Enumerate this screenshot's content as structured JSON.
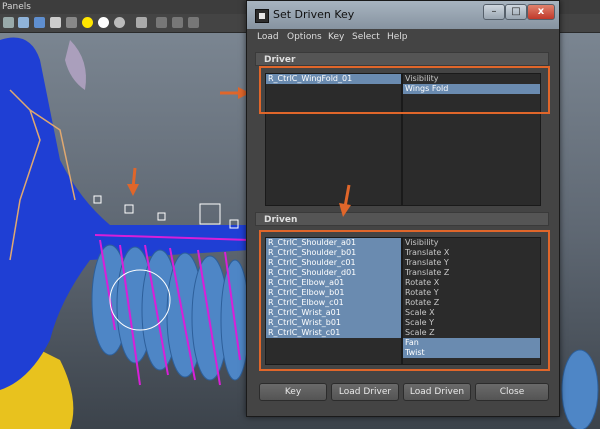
{
  "background": {
    "menu_label": "Panels"
  },
  "dialog": {
    "title": "Set Driven Key",
    "window_buttons": {
      "minimize": "–",
      "maximize": "□",
      "close": "x"
    },
    "menu": [
      "Load",
      "Options",
      "Key",
      "Select",
      "Help"
    ],
    "driver": {
      "header": "Driver",
      "objects": [
        {
          "label": "R_CtrlC_WingFold_01",
          "selected": true
        }
      ],
      "attributes": [
        {
          "label": "Visibility",
          "selected": false
        },
        {
          "label": "Wings Fold",
          "selected": true
        }
      ]
    },
    "driven": {
      "header": "Driven",
      "objects": [
        {
          "label": "R_CtrlC_Shoulder_a01",
          "selected": true
        },
        {
          "label": "R_CtrlC_Shoulder_b01",
          "selected": true
        },
        {
          "label": "R_CtrlC_Shoulder_c01",
          "selected": true
        },
        {
          "label": "R_CtrlC_Shoulder_d01",
          "selected": true
        },
        {
          "label": "R_CtrlC_Elbow_a01",
          "selected": true
        },
        {
          "label": "R_CtrlC_Elbow_b01",
          "selected": true
        },
        {
          "label": "R_CtrlC_Elbow_c01",
          "selected": true
        },
        {
          "label": "R_CtrlC_Wrist_a01",
          "selected": true
        },
        {
          "label": "R_CtrlC_Wrist_b01",
          "selected": true
        },
        {
          "label": "R_CtrlC_Wrist_c01",
          "selected": true
        }
      ],
      "attributes": [
        {
          "label": "Visibility",
          "selected": false
        },
        {
          "label": "Translate X",
          "selected": false
        },
        {
          "label": "Translate Y",
          "selected": false
        },
        {
          "label": "Translate Z",
          "selected": false
        },
        {
          "label": "Rotate X",
          "selected": false
        },
        {
          "label": "Rotate Y",
          "selected": false
        },
        {
          "label": "Rotate Z",
          "selected": false
        },
        {
          "label": "Scale X",
          "selected": false
        },
        {
          "label": "Scale Y",
          "selected": false
        },
        {
          "label": "Scale Z",
          "selected": false
        },
        {
          "label": "Fan",
          "selected": true
        },
        {
          "label": "Twist",
          "selected": true
        }
      ]
    },
    "buttons": {
      "key": "Key",
      "load_driver": "Load Driver",
      "load_driven": "Load Driven",
      "close": "Close"
    }
  },
  "colors": {
    "highlight": "#e0662a",
    "selection": "#6a8bb0"
  }
}
